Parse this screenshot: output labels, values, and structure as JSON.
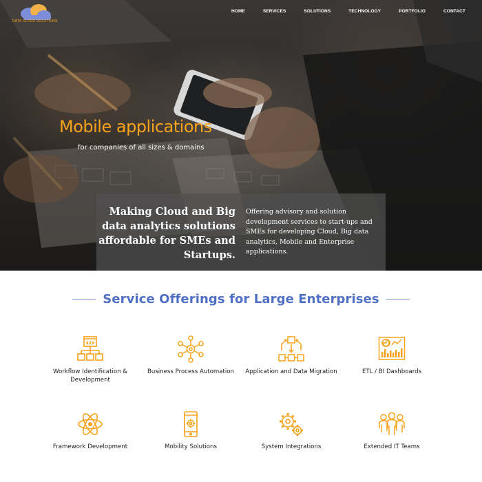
{
  "brand": {
    "logo_icon": "cloud-logo-icon",
    "logo_text": "DATA CLOUD SOLUTIONS",
    "accent_color": "#f7a21b",
    "heading_color": "#4f6fc4"
  },
  "nav": {
    "items": [
      {
        "label": "HOME"
      },
      {
        "label": "SERVICES"
      },
      {
        "label": "SOLUTIONS"
      },
      {
        "label": "TECHNOLOGY"
      },
      {
        "label": "PORTFOLIO"
      },
      {
        "label": "CONTACT"
      }
    ]
  },
  "hero": {
    "title": "Mobile applications",
    "subtitle": "for companies of all sizes & domains",
    "tagline": "Making Cloud and Big data analytics solutions affordable for SMEs and Startups.",
    "description": "Offering advisory and solution development services to start-ups and SMEs for developing Cloud, Big data analytics, Mobile and Enterprise applications."
  },
  "services": {
    "heading": "Service Offerings for Large Enterprises",
    "items": [
      {
        "label": "Workflow Identification & Development",
        "icon": "workflow-icon"
      },
      {
        "label": "Business Process Automation",
        "icon": "process-automation-icon"
      },
      {
        "label": "Application and Data Migration",
        "icon": "data-migration-icon"
      },
      {
        "label": "ETL / BI Dashboards",
        "icon": "dashboard-icon"
      },
      {
        "label": "Framework Development",
        "icon": "atom-icon"
      },
      {
        "label": "Mobility Solutions",
        "icon": "mobile-gear-icon"
      },
      {
        "label": "System Integrations",
        "icon": "gears-icon"
      },
      {
        "label": "Extended IT Teams",
        "icon": "team-icon"
      }
    ]
  }
}
